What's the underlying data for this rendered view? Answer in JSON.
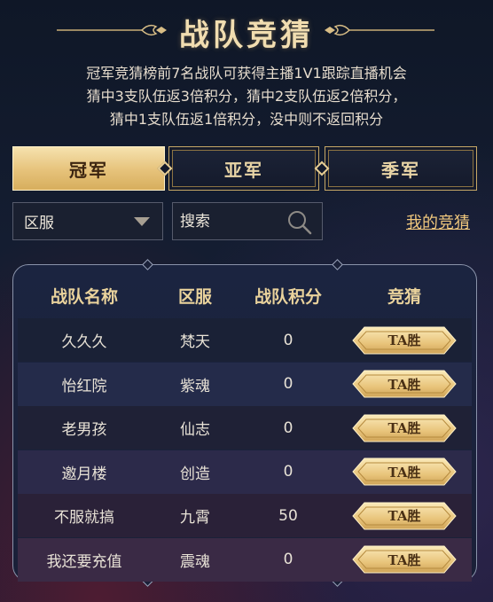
{
  "header": {
    "title": "战队竞猜",
    "rules": [
      "冠军竞猜榜前7名战队可获得主播1V1跟踪直播机会",
      "猜中3支队伍返3倍积分，猜中2支队伍返2倍积分，",
      "猜中1支队伍返1倍积分，没中则不返回积分"
    ]
  },
  "tabs": [
    {
      "label": "冠军",
      "active": true
    },
    {
      "label": "亚军",
      "active": false
    },
    {
      "label": "季军",
      "active": false
    }
  ],
  "filters": {
    "server_select_value": "区服",
    "search_placeholder": "搜索",
    "my_bets_link": "我的竞猜"
  },
  "table": {
    "columns": [
      "战队名称",
      "区服",
      "战队积分",
      "竞猜"
    ],
    "rows": [
      {
        "team": "久久久",
        "server": "梵天",
        "points": "0",
        "action": "TA胜"
      },
      {
        "team": "怡红院",
        "server": "紫魂",
        "points": "0",
        "action": "TA胜"
      },
      {
        "team": "老男孩",
        "server": "仙志",
        "points": "0",
        "action": "TA胜"
      },
      {
        "team": "邀月楼",
        "server": "创造",
        "points": "0",
        "action": "TA胜"
      },
      {
        "team": "不服就搞",
        "server": "九霄",
        "points": "50",
        "action": "TA胜"
      },
      {
        "team": "我还要充值",
        "server": "震魂",
        "points": "0",
        "action": "TA胜"
      }
    ]
  },
  "colors": {
    "accent_gold": "#e6c27a",
    "link_gold": "#f0c77d",
    "background": "#141d31"
  },
  "icons": [
    "caret-down-icon",
    "search-icon",
    "tab-diamond-icon"
  ]
}
